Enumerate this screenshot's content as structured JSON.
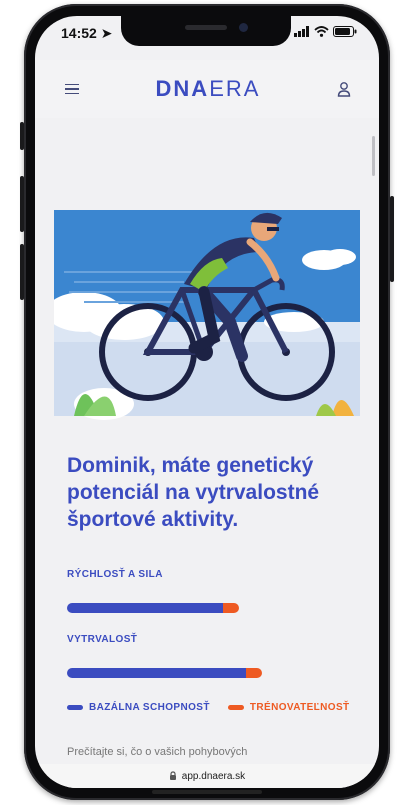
{
  "status": {
    "time": "14:52"
  },
  "header": {
    "logo_bold": "DNA",
    "logo_light": "ERA"
  },
  "headline": "Dominik, máte genetický potenciál na vytrvalostné športové aktivity.",
  "metrics": [
    {
      "label": "RÝCHLOSŤ A SILA",
      "base": 0.68,
      "trainable": 0.07
    },
    {
      "label": "VYTRVALOSŤ",
      "base": 0.78,
      "trainable": 0.07
    }
  ],
  "legend": {
    "base": {
      "label": "BAZÁLNA SCHOPNOSŤ",
      "color": "#3b4cc0"
    },
    "trainable": {
      "label": "TRÉNOVATEĽNOSŤ",
      "color": "#ee5a22"
    }
  },
  "footer_text": "Prečítajte si, čo o vašich pohybových",
  "urlbar": {
    "url": "app.dnaera.sk"
  }
}
